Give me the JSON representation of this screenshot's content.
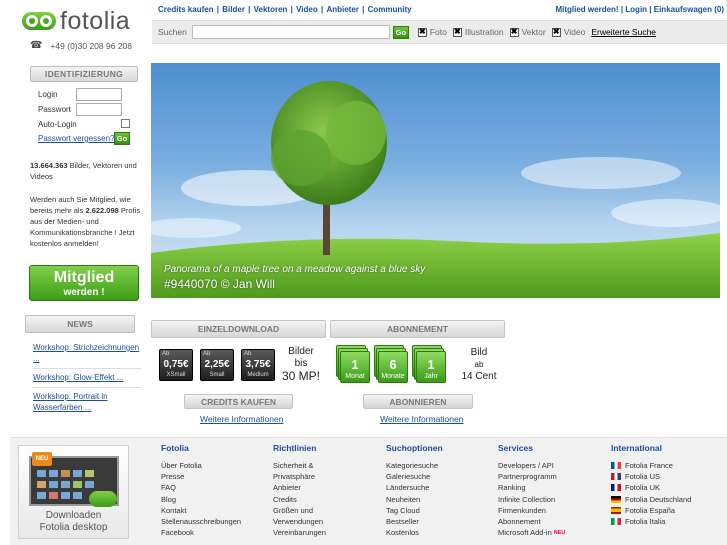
{
  "brand": {
    "logo_text": "fotolia",
    "phone": "+49 (0)30 208 96 208"
  },
  "topnav": {
    "items": [
      "Credits kaufen",
      "Bilder",
      "Vektoren",
      "Video",
      "Anbieter",
      "Community"
    ],
    "user_items": [
      "Mitglied werden!",
      "Login",
      "Einkaufswagen (0)"
    ]
  },
  "search": {
    "label": "Suchen",
    "value": "",
    "go_label": "Go",
    "filters": [
      {
        "label": "Foto",
        "checked": true
      },
      {
        "label": "Illustration",
        "checked": true
      },
      {
        "label": "Vektor",
        "checked": true
      },
      {
        "label": "Video",
        "checked": true
      }
    ],
    "advanced": "Erweiterte Suche"
  },
  "login": {
    "header": "IDENTIFIZIERUNG",
    "login_label": "Login",
    "password_label": "Passwort",
    "autologin_label": "Auto-Login",
    "forgot": "Passwort vergessen?",
    "go_label": "Go"
  },
  "stats": {
    "count": "13.664.363",
    "text": "Bilder, Vektoren und Videos"
  },
  "member": {
    "text_before": "Werden auch Sie Mitglied, wie bereits mehr als",
    "count": "2.622.098",
    "text_after": "Profis aus der Medien- und Kommunikationsbranche ! Jetzt kostenlos anmelden!",
    "button_line1": "Mitglied",
    "button_line2": "werden !"
  },
  "news": {
    "header": "NEWS",
    "items": [
      "Workshop: Strichzeichnungen ...",
      "Workshop: Glow-Effekt ...",
      "Workshop: Portrait in Wasserfarben ..."
    ]
  },
  "hero": {
    "caption": "Panorama of a maple tree on a meadow against a blue sky",
    "credit": "#9440070  © Jan Will"
  },
  "einzeldownload": {
    "header": "EINZELDOWNLOAD",
    "prices": [
      {
        "ab": "Ab",
        "price": "0,75€",
        "size": "XSmall"
      },
      {
        "ab": "Ab",
        "price": "2,25€",
        "size": "Small"
      },
      {
        "ab": "Ab",
        "price": "3,75€",
        "size": "Medium"
      }
    ],
    "side_line1": "Bilder",
    "side_line2": "bis",
    "side_line3": "30 MP!",
    "button": "CREDITS KAUFEN",
    "more": "Weitere Informationen"
  },
  "abonnement": {
    "header": "ABONNEMENT",
    "plans": [
      {
        "num": "1",
        "period": "Monat"
      },
      {
        "num": "6",
        "period": "Monate"
      },
      {
        "num": "1",
        "period": "Jahr"
      }
    ],
    "side_line1": "Bild",
    "side_line2": "ab",
    "side_line3": "14 Cent",
    "button": "ABONNIEREN",
    "more": "Weitere Informationen"
  },
  "promo": {
    "badge": "NEU",
    "line1": "Downloaden",
    "line2": "Fotolia desktop"
  },
  "footer": {
    "columns": [
      {
        "title": "Fotolia",
        "links": [
          "Über Fotolia",
          "Presse",
          "FAQ",
          "Blog",
          "Kontakt",
          "Stellenausschreibungen",
          "Facebook"
        ]
      },
      {
        "title": "Richtlinien",
        "links": [
          "Sicherheit &",
          "Privatsphäre",
          "Anbieter",
          "Credits",
          "Größen und",
          "Verwendungen",
          "Vereinbarungen"
        ]
      },
      {
        "title": "Suchoptionen",
        "links": [
          "Kategoriesuche",
          "Galeriesuche",
          "Ländersuche",
          "Neuheiten",
          "Tag Cloud",
          "Bestseller",
          "Kostenlos"
        ]
      },
      {
        "title": "Services",
        "links": [
          "Developers / API",
          "Partnerprogramm",
          "Ranking",
          "Infinite Collection",
          "Firmenkunden",
          "Abonnement",
          "Microsoft Add-in"
        ]
      },
      {
        "title": "International",
        "links": [
          "Fotolia France",
          "Fotolia US",
          "Fotolia UK",
          "Fotolia Deutschland",
          "Fotolia España",
          "Fotolia Italia"
        ]
      }
    ],
    "new_tag": "NEU",
    "flag_colors": [
      [
        "#0055a4",
        "#ffffff",
        "#ef4135"
      ],
      [
        "#b22234",
        "#ffffff",
        "#3c3b6e"
      ],
      [
        "#012169",
        "#ffffff",
        "#c8102e"
      ],
      [
        "#000000",
        "#dd0000",
        "#ffce00"
      ],
      [
        "#aa151b",
        "#f1bf00",
        "#aa151b"
      ],
      [
        "#009246",
        "#ffffff",
        "#ce2b37"
      ]
    ]
  },
  "colors": {
    "accent_green": "#48a61f",
    "link_blue": "#1a4fa0"
  }
}
